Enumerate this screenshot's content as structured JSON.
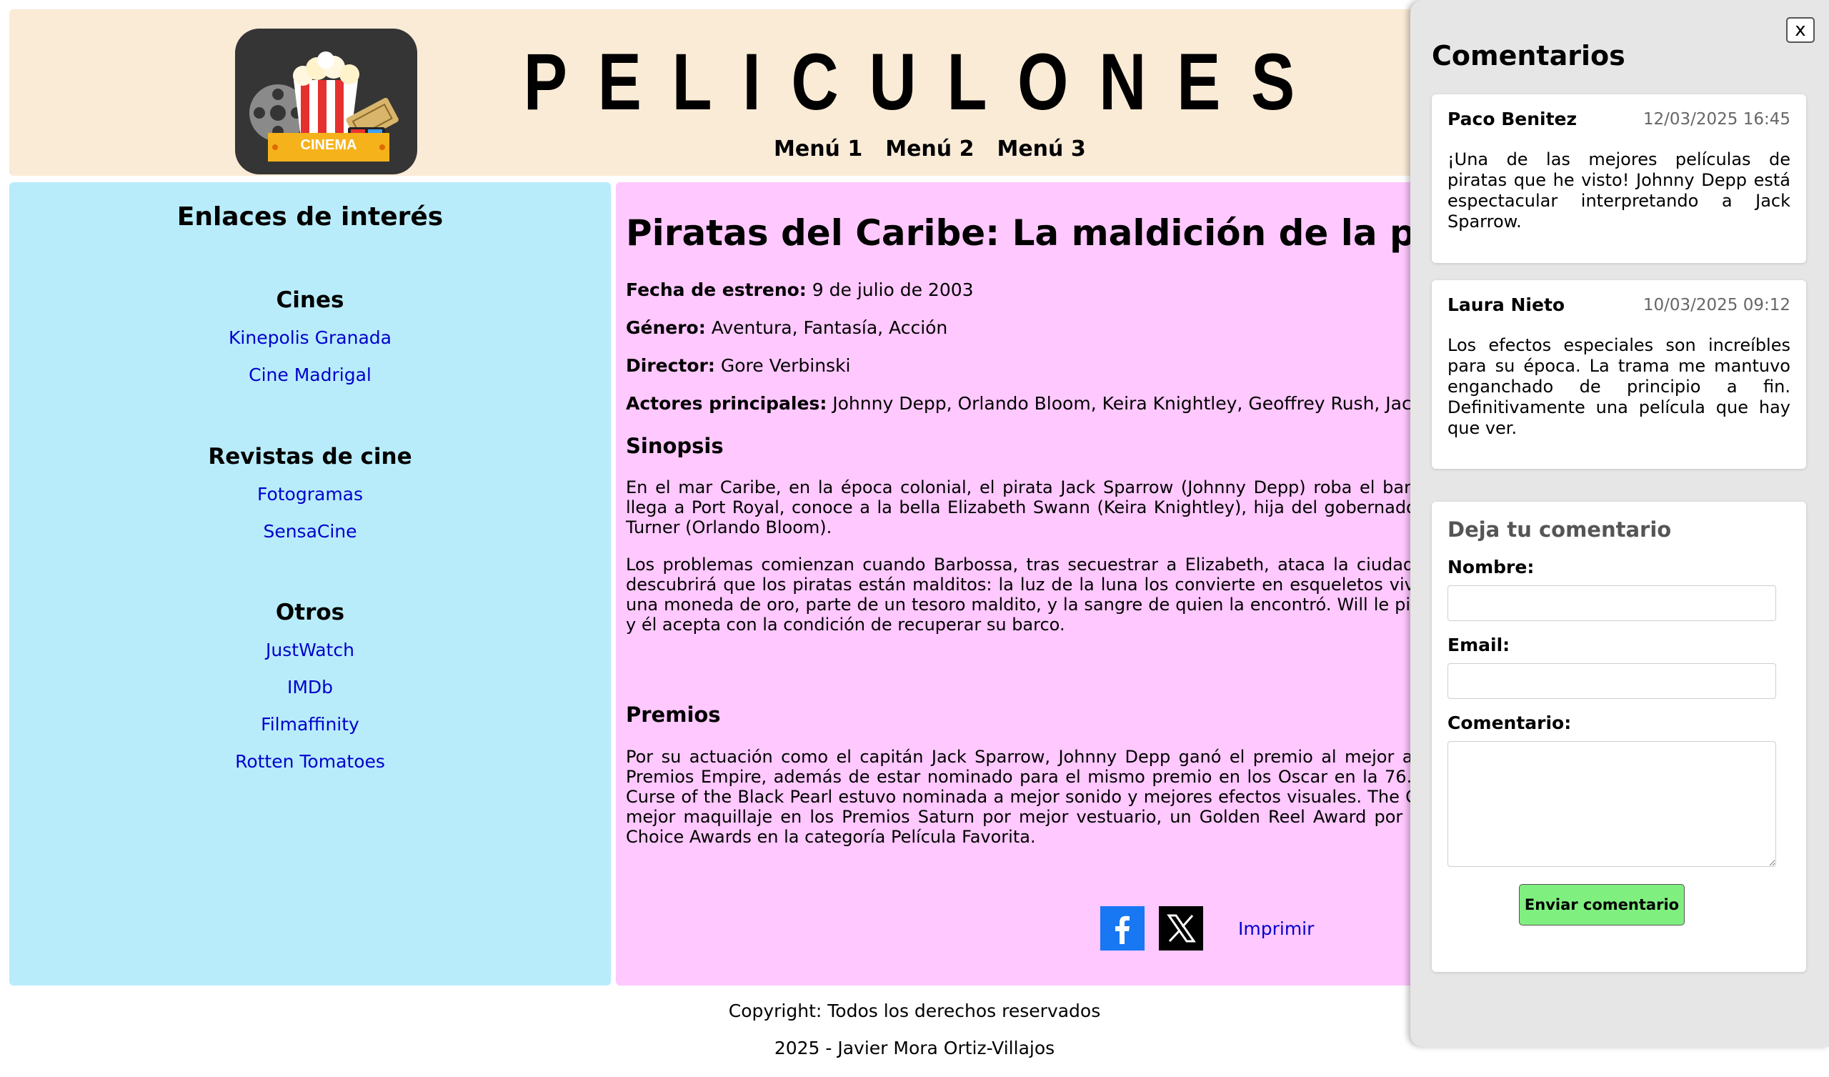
{
  "header": {
    "site_title": "PELICULONES",
    "logo_text": "CINEMA",
    "nav": [
      "Menú 1",
      "Menú 2",
      "Menú 3"
    ]
  },
  "sidebar": {
    "title": "Enlaces de interés",
    "groups": [
      {
        "heading": "Cines",
        "links": [
          "Kinepolis Granada",
          "Cine Madrigal"
        ]
      },
      {
        "heading": "Revistas de cine",
        "links": [
          "Fotogramas",
          "SensaCine"
        ]
      },
      {
        "heading": "Otros",
        "links": [
          "JustWatch",
          "IMDb",
          "Filmaffinity",
          "Rotten Tomatoes"
        ]
      }
    ]
  },
  "movie": {
    "title": "Piratas del Caribe: La maldición de la perla negra",
    "release_label": "Fecha de estreno:",
    "release_value": "9 de julio de 2003",
    "genre_label": "Género:",
    "genre_value": "Aventura, Fantasía, Acción",
    "director_label": "Director:",
    "director_value": "Gore Verbinski",
    "actors_label": "Actores principales:",
    "actors_value": "Johnny Depp, Orlando Bloom, Keira Knightley, Geoffrey Rush, Jack Davenport",
    "synopsis_heading": "Sinopsis",
    "synopsis_p1": "En el mar Caribe, en la época colonial, el pirata Jack Sparrow (Johnny Depp) roba el barco de Barbossa (Geoffrey Rush). Cuando llega a Port Royal, conoce a la bella Elizabeth Swann (Keira Knightley), hija del gobernador y de la que se enamora el herrero Will Turner (Orlando Bloom).",
    "synopsis_p2": "Los problemas comienzan cuando Barbossa, tras secuestrar a Elizabeth, ataca la ciudad con su barco, la Perla Negra. Elizabeth descubrirá que los piratas están malditos: la luz de la luna los convierte en esqueletos vivientes. Para romper el hechizo necesitan una moneda de oro, parte de un tesoro maldito, y la sangre de quien la encontró. Will le pide ayuda a Jack para rescatar a Elizabeth y él acepta con la condición de recuperar su barco.",
    "awards_heading": "Premios",
    "awards_p": "Por su actuación como el capitán Jack Sparrow, Johnny Depp ganó el premio al mejor actor en los Premios MTV Movie y en los Premios Empire, además de estar nominado para el mismo premio en los Oscar en la 76.ª Ceremonia de los Oscar, en la que The Curse of the Black Pearl estuvo nominada a mejor sonido y mejores efectos visuales. The Curse of the Black Pearl ganó el premio al mejor maquillaje en los Premios Saturn por mejor vestuario, un Golden Reel Award por la mejor edición de sonido, dos People's Choice Awards en la categoría Película Favorita.",
    "print_label": "Imprimir"
  },
  "footer": {
    "line1": "Copyright: Todos los derechos reservados",
    "line2": "2025 - Javier Mora Ortiz-Villajos"
  },
  "comments": {
    "close_label": "x",
    "title": "Comentarios",
    "items": [
      {
        "author": "Paco Benitez",
        "date": "12/03/2025 16:45",
        "text": "¡Una de las mejores películas de piratas que he visto! Johnny Depp está espectacular interpretando a Jack Sparrow."
      },
      {
        "author": "Laura Nieto",
        "date": "10/03/2025 09:12",
        "text": "Los efectos especiales son increíbles para su época. La trama me mantuvo enganchado de principio a fin. Definitivamente una película que hay que ver."
      }
    ],
    "form": {
      "title": "Deja tu comentario",
      "name_label": "Nombre:",
      "email_label": "Email:",
      "comment_label": "Comentario:",
      "name_value": "",
      "email_value": "",
      "comment_value": "",
      "submit_label": "Enviar comentario"
    }
  },
  "colors": {
    "header_bg": "#faebd7",
    "sidebar_bg": "#b8ecfa",
    "main_bg": "#ffc8fe",
    "drawer_bg": "#e6e6e6",
    "link": "#0000cc",
    "submit_bg": "#7fef7f"
  },
  "icons": [
    "cinema-logo-icon",
    "facebook-icon",
    "x-twitter-icon",
    "close-icon"
  ]
}
